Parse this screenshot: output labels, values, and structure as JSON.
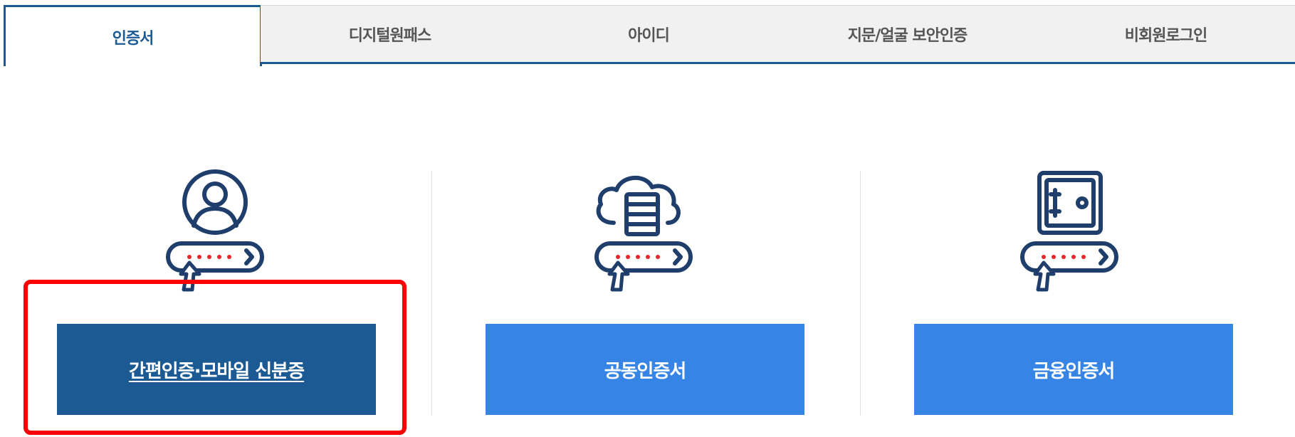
{
  "tabs": [
    {
      "label": "인증서",
      "active": true
    },
    {
      "label": "디지털원패스",
      "active": false
    },
    {
      "label": "아이디",
      "active": false
    },
    {
      "label": "지문/얼굴 보안인증",
      "active": false
    },
    {
      "label": "비회원로그인",
      "active": false
    }
  ],
  "options": [
    {
      "label": "간편인증·모바일 신분증",
      "icon": "user-profile-icon",
      "style": "selected"
    },
    {
      "label": "공동인증서",
      "icon": "cloud-server-icon",
      "style": "default"
    },
    {
      "label": "금융인증서",
      "icon": "safe-icon",
      "style": "default"
    }
  ],
  "colors": {
    "primary_dark": "#1c5a94",
    "primary_light": "#3685e6",
    "tab_bg": "#f1f1f1",
    "highlight": "#ff0000",
    "password_dots": "#e8262b"
  }
}
